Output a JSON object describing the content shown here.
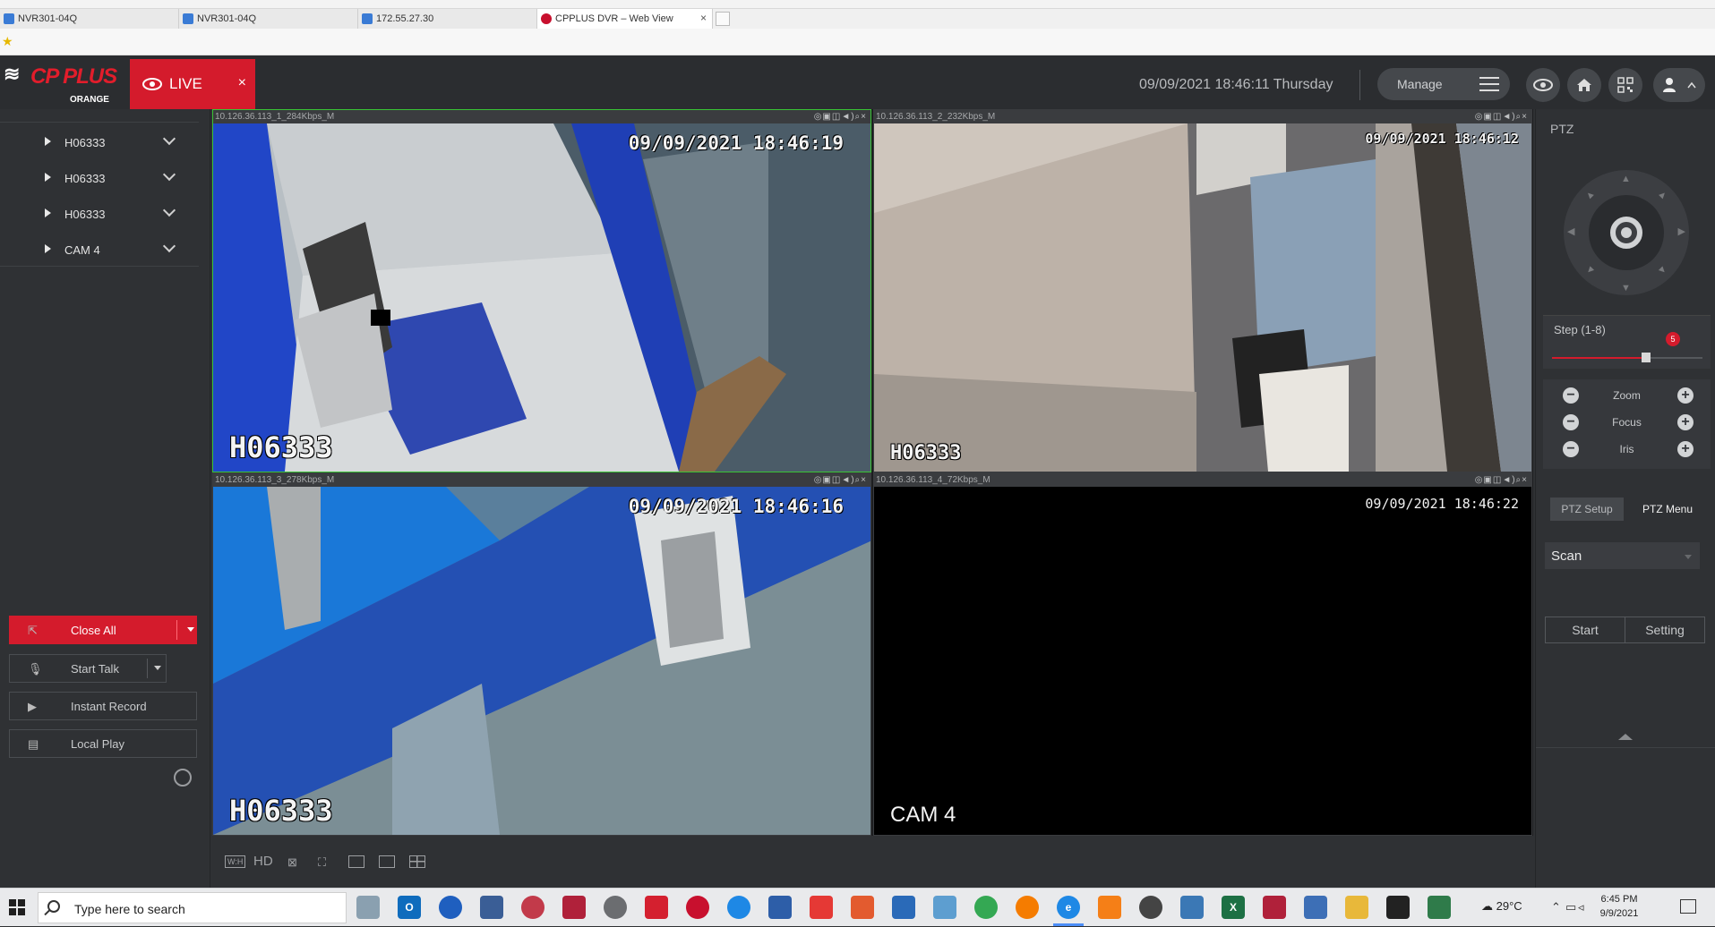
{
  "browser": {
    "tabs": [
      {
        "label": "NVR301-04Q",
        "active": false
      },
      {
        "label": "NVR301-04Q",
        "active": false
      },
      {
        "label": "172.55.27.30",
        "active": false
      },
      {
        "label": "CPPLUS DVR – Web View",
        "active": true
      }
    ],
    "close_glyph": "×"
  },
  "header": {
    "logo_text": "CP PLUS",
    "logo_sub": "ORANGE",
    "live_tab_label": "LIVE",
    "close_glyph": "×",
    "datetime": "09/09/2021 18:46:11 Thursday",
    "manage_label": "Manage",
    "icons": [
      "eye-icon",
      "home-icon",
      "qr-code-icon",
      "user-icon"
    ],
    "accent_color": "#d41b2c"
  },
  "sidebar": {
    "devices": [
      {
        "name": "H06333"
      },
      {
        "name": "H06333"
      },
      {
        "name": "H06333"
      },
      {
        "name": "CAM 4"
      }
    ],
    "buttons": {
      "close_all": "Close All",
      "start_talk": "Start Talk",
      "instant_record": "Instant Record",
      "local_play": "Local Play"
    }
  },
  "grid": {
    "panes": [
      {
        "stream": "10.126.36.113_1_284Kbps_M",
        "timestamp": "09/09/2021  18:46:19",
        "name": "H06333",
        "selected": true
      },
      {
        "stream": "10.126.36.113_2_232Kbps_M",
        "timestamp": "09/09/2021  18:46:12",
        "name": "H06333",
        "selected": false
      },
      {
        "stream": "10.126.36.113_3_278Kbps_M",
        "timestamp": "09/09/2021  18:46:16",
        "name": "H06333",
        "selected": false
      },
      {
        "stream": "10.126.36.113_4_72Kbps_M",
        "timestamp": "09/09/2021  18:46:22",
        "name": "CAM 4",
        "selected": false
      }
    ],
    "pane_controls": "◎▣◫◄)⌕×",
    "toolbar": {
      "hd_label": "HD",
      "wh_label": "W:H"
    }
  },
  "ptz": {
    "title": "PTZ",
    "step_label": "Step (1-8)",
    "step_value": 5,
    "step_max": 8,
    "zoom_label": "Zoom",
    "focus_label": "Focus",
    "iris_label": "Iris",
    "minus": "−",
    "plus": "+",
    "tabs": {
      "setup": "PTZ Setup",
      "menu": "PTZ Menu"
    },
    "scan_value": "Scan",
    "start_label": "Start",
    "setting_label": "Setting"
  },
  "taskbar": {
    "search_placeholder": "Type here to search",
    "weather": "29°C",
    "time": "6:45 PM",
    "date": "9/9/2021"
  }
}
